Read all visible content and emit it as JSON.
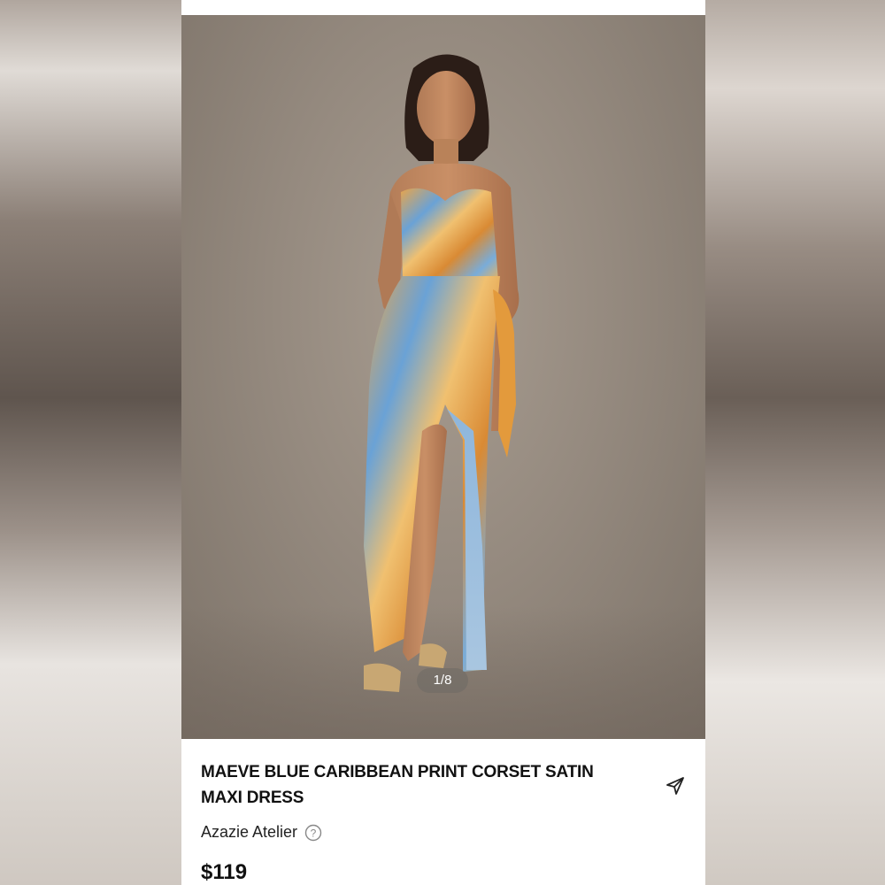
{
  "product": {
    "title": "MAEVE BLUE CARIBBEAN PRINT CORSET SATIN MAXI DRESS",
    "brand": "Azazie Atelier",
    "price": "$119"
  },
  "gallery": {
    "page_indicator": "1/8",
    "image_alt": "Model wearing strapless corset satin maxi dress with blue and orange print"
  },
  "icons": {
    "share": "share-send-icon",
    "help": "question-circle-icon"
  },
  "colors": {
    "print_orange": "#e39a3c",
    "print_blue": "#5a93c9",
    "text_primary": "#111111"
  }
}
